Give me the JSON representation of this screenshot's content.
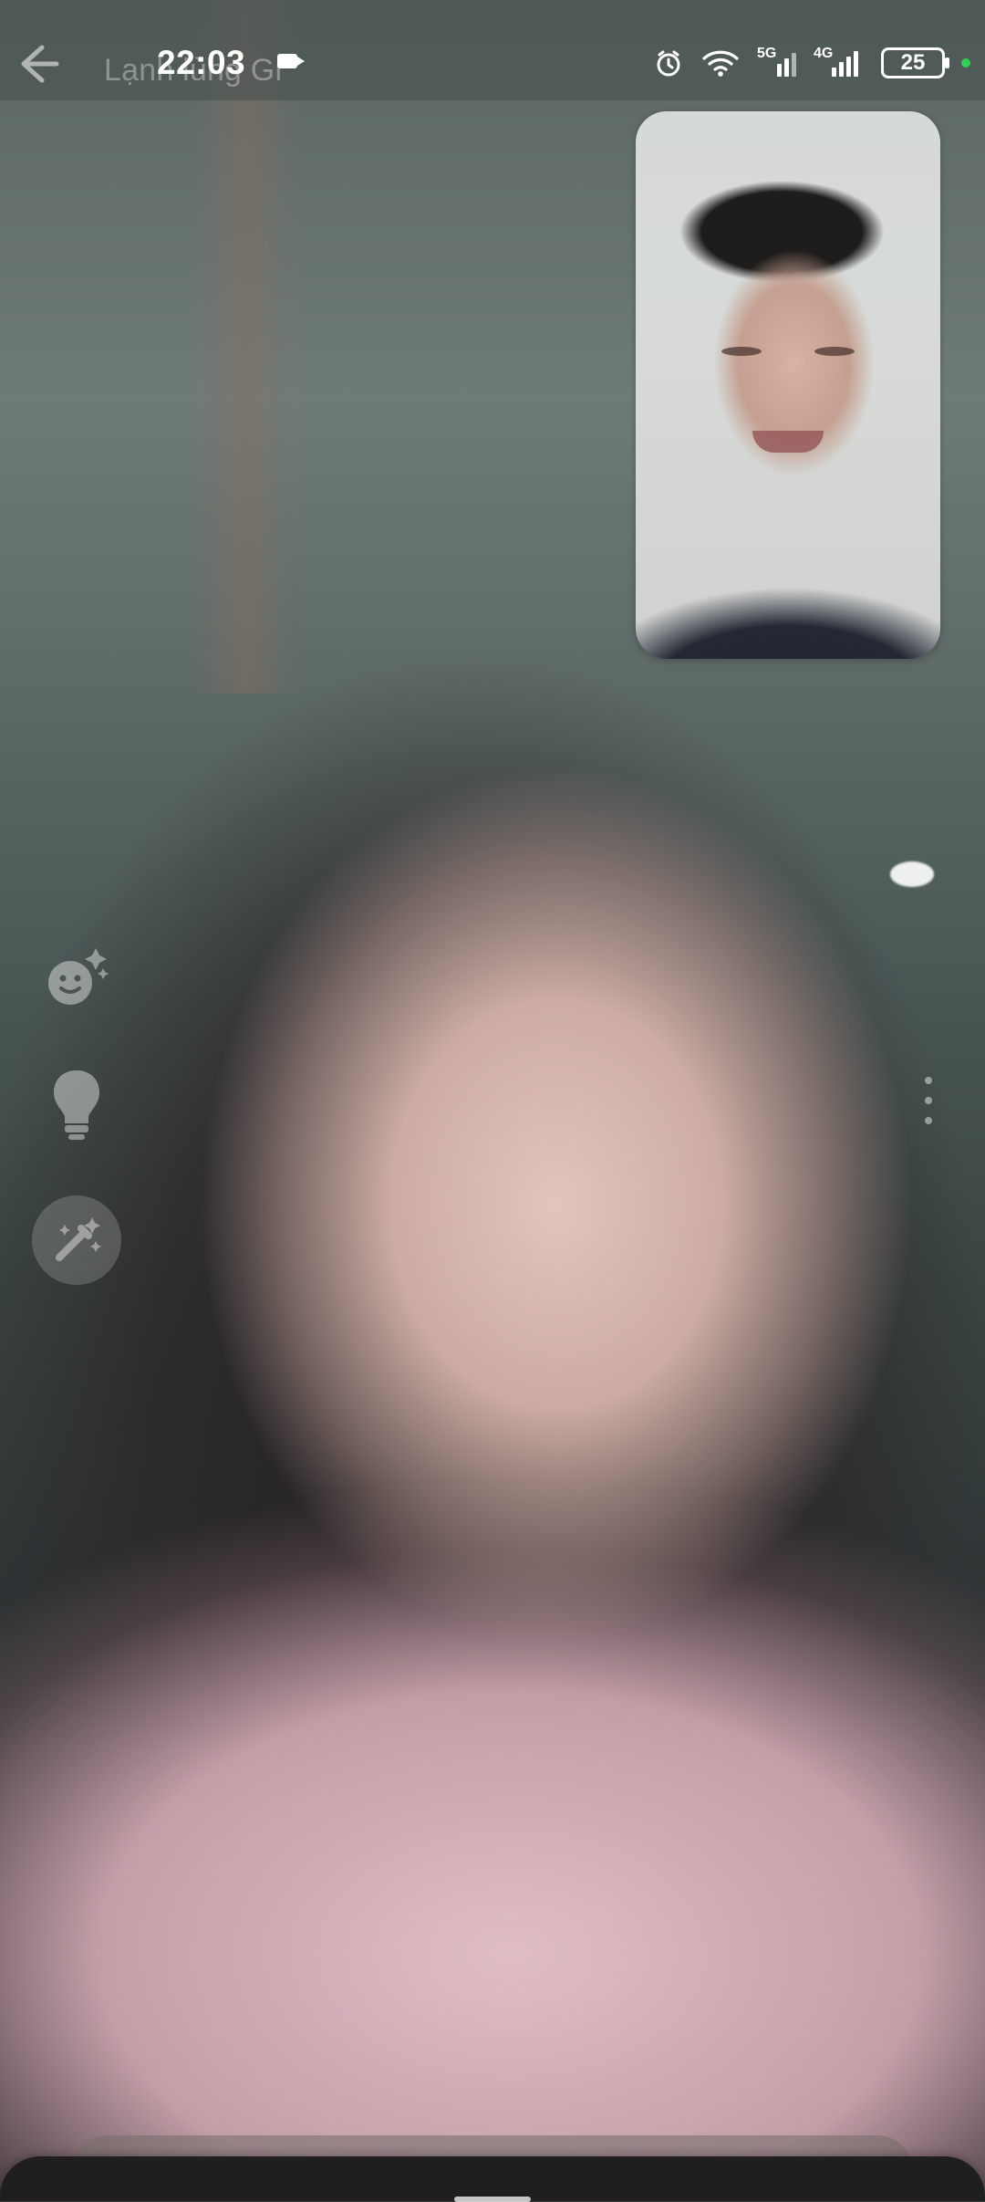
{
  "status_bar": {
    "time": "22:03",
    "network_5g": "5G",
    "network_4g": "4G",
    "battery_level": "25"
  },
  "call": {
    "title": "Lạnh lùng Gr"
  },
  "colors": {
    "status_green": "#31d158",
    "sheet_bg": "#1f1f1f"
  },
  "icons": {
    "back": "arrow-left-icon",
    "camera": "camera-icon",
    "alarm": "alarm-icon",
    "wifi": "wifi-icon",
    "signal": "signal-icon",
    "battery": "battery-icon",
    "face_effects": "face-effects-icon",
    "lightbulb": "lightbulb-icon",
    "magic": "magic-wand-icon",
    "more": "more-dots-icon"
  }
}
